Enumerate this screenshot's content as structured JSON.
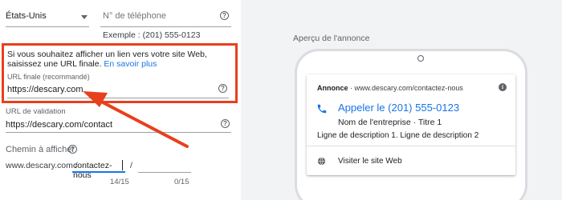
{
  "form": {
    "country": "États-Unis",
    "phone_placeholder": "N° de téléphone",
    "phone_example": "Exemple : (201) 555-0123",
    "final_url_message": "Si vous souhaitez afficher un lien vers votre site Web, saisissez une URL finale.",
    "learn_more": "En savoir plus",
    "final_url_label": "URL finale (recommandé)",
    "final_url_value": "https://descary.com",
    "validation_label": "URL de validation",
    "validation_value": "https://descary.com/contact",
    "display_path_label": "Chemin à afficher",
    "display_path_base": "www.descary.com /",
    "path1_value": "contactez-nous",
    "path_separator": "/",
    "path2_value": "",
    "path1_counter": "14/15",
    "path2_counter": "0/15",
    "help_glyph": "?"
  },
  "preview": {
    "title": "Aperçu de l'annonce",
    "ad_label": "Annonce",
    "ad_url": "· www.descary.com/contactez-nous",
    "info_glyph": "i",
    "call_text": "Appeler le (201) 555-0123",
    "business_line": "Nom de l'entreprise · Titre 1",
    "description": "Ligne de description 1. Ligne de description 2",
    "visit_text": "Visiter le site Web"
  },
  "colors": {
    "highlight": "#e8401c",
    "link": "#1a73e8",
    "preview_bg": "#f1f3f4"
  },
  "icons": [
    "chevron-down-icon",
    "help-icon",
    "info-icon",
    "phone-icon",
    "globe-icon",
    "arrow-annotation"
  ]
}
